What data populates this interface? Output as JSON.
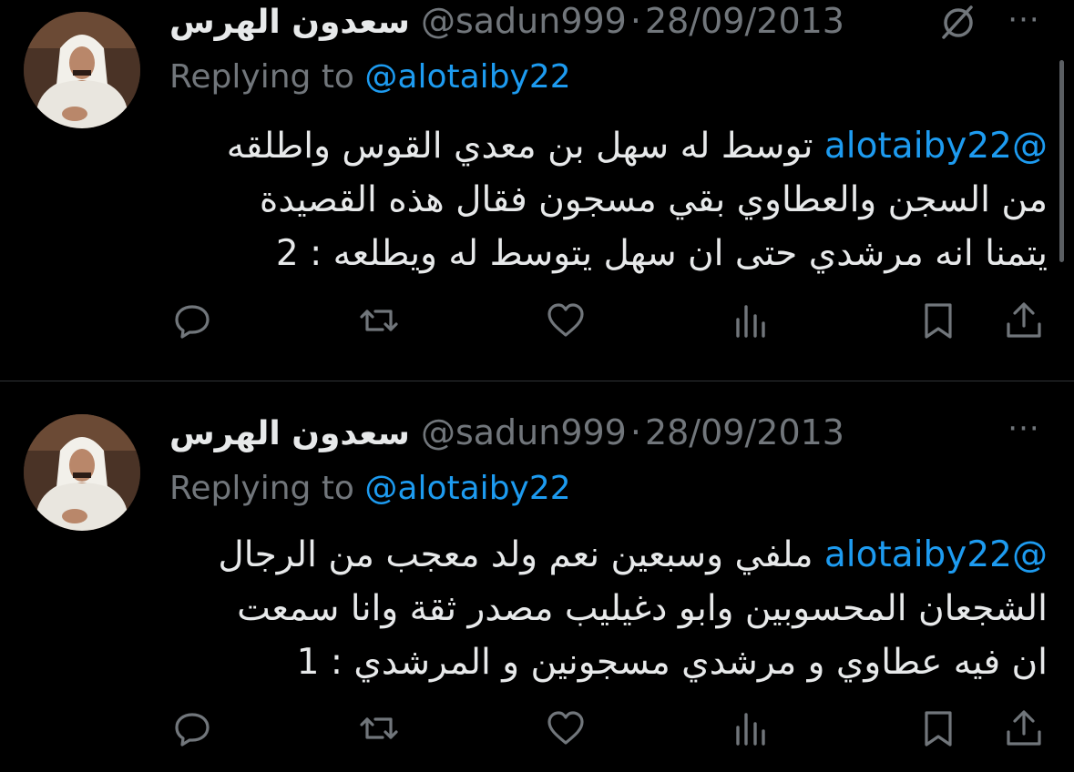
{
  "tweets": [
    {
      "author_name": "سعدون الهرس",
      "handle": "@sadun999",
      "separator": "·",
      "date": "28/09/2013",
      "replying_prefix": "Replying to",
      "replying_to": "@alotaiby22",
      "body_mention": "@alotaiby22",
      "body_lines": [
        "توسط له سهل بن معدي القوس واطلقه",
        "من السجن والعطاوي بقي مسجون فقال هذه القصيدة",
        "يتمنا انه مرشدي حتى ان سهل يتوسط له ويطلعه : 2"
      ],
      "more_label": "···",
      "icons": [
        "reply-icon",
        "retweet-icon",
        "like-icon",
        "views-icon",
        "bookmark-icon",
        "share-icon"
      ]
    },
    {
      "author_name": "سعدون الهرس",
      "handle": "@sadun999",
      "separator": "·",
      "date": "28/09/2013",
      "replying_prefix": "Replying to",
      "replying_to": "@alotaiby22",
      "body_mention": "@alotaiby22",
      "body_lines": [
        "ملفي وسبعين نعم ولد معجب من الرجال",
        "الشجعان المحسوبين وابو دغيليب مصدر ثقة وانا سمعت",
        "ان فيه عطاوي و مرشدي مسجونين و المرشدي : 1"
      ],
      "more_label": "···",
      "icons": [
        "reply-icon",
        "retweet-icon",
        "like-icon",
        "views-icon",
        "bookmark-icon",
        "share-icon"
      ]
    }
  ],
  "colors": {
    "background": "#000000",
    "text": "#e7e9ea",
    "muted": "#71767b",
    "accent": "#1d9bf0",
    "divider": "#2f3336"
  }
}
